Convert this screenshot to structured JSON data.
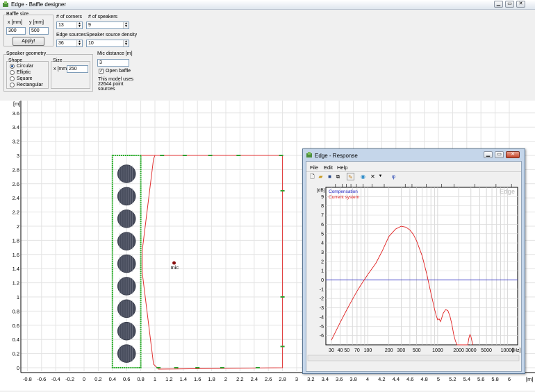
{
  "window": {
    "title": "Edge - Baffle designer"
  },
  "controls": {
    "baffle_size_label": "Baffle size",
    "x_label": "x [mm]",
    "y_label": "y [mm]",
    "x_value": "300",
    "y_value": "500",
    "apply_label": "Apply!",
    "corners_label": "# of corners",
    "corners_value": "13",
    "speakers_label": "# of speakers",
    "speakers_value": "9",
    "edge_sources_label": "Edge sources",
    "edge_sources_value": "36",
    "density_label": "Speaker source density",
    "density_value": "10",
    "geometry_label": "Speaker geometry",
    "shape_label": "Shape",
    "shapes": [
      "Circular",
      "Elliptic",
      "Square",
      "Rectangular"
    ],
    "size_label": "Size",
    "size_x_label": "x [mm]",
    "size_x_value": "250",
    "mic_distance_label": "Mic distance [m]",
    "mic_distance_value": "3",
    "open_baffle_label": "Open baffle",
    "model_info": [
      "This model uses",
      "22644 point",
      "sources"
    ]
  },
  "main_plot": {
    "unit_label": "[m]",
    "x_ticks": [
      "-0.8",
      "-0.6",
      "-0.4",
      "-0.2",
      "0",
      "0.2",
      "0.4",
      "0.6",
      "0.8",
      "1",
      "1.2",
      "1.4",
      "1.6",
      "1.8",
      "2",
      "2.2",
      "2.4",
      "2.6",
      "2.8",
      "3",
      "3.2",
      "3.4",
      "3.6",
      "3.8",
      "4",
      "4.2",
      "4.4",
      "4.6",
      "4.8",
      "5",
      "5.2",
      "5.4",
      "5.6",
      "5.8",
      "6"
    ],
    "y_ticks": [
      "0",
      "0.2",
      "0.4",
      "0.6",
      "0.8",
      "1",
      "1.2",
      "1.4",
      "1.6",
      "1.8",
      "2",
      "2.2",
      "2.4",
      "2.6",
      "2.8",
      "3",
      "3.2",
      "3.4",
      "3.6"
    ],
    "mic_label": "mic",
    "speaker_count": 9
  },
  "response_window": {
    "title": "Edge - Response",
    "menu": [
      "File",
      "Edit",
      "Help"
    ],
    "toolbar_icons": [
      "new-icon",
      "open-icon",
      "save-icon",
      "copy-icon",
      "pencil-icon",
      "globe-icon",
      "cross-icon",
      "dropdown-icon",
      "phi-icon"
    ],
    "top_axis_labels": [
      "10",
      "8",
      "7",
      "6",
      "5",
      "4",
      "3",
      "2",
      "1",
      "0.8",
      "0.5",
      "0.3",
      "0.2",
      "0.1",
      "0.05",
      "0.03"
    ],
    "top_unit": "[m]",
    "db_unit": "[dB]",
    "hz_unit": "[Hz]",
    "y_ticks": [
      "9",
      "8",
      "7",
      "6",
      "5",
      "4",
      "3",
      "2",
      "1",
      "0",
      "-1",
      "-2",
      "-3",
      "-4",
      "-5",
      "-6"
    ],
    "x_ticks": [
      "30",
      "40",
      "50",
      "70",
      "100",
      "200",
      "300",
      "500",
      "1000",
      "2000",
      "3000",
      "5000",
      "10000"
    ],
    "legend": [
      {
        "name": "Compensation",
        "color": "#2020c0"
      },
      {
        "name": "Current system",
        "color": "#e02020"
      }
    ],
    "watermark": "Edge"
  },
  "chart_data": {
    "type": "line",
    "xlabel": "[Hz]",
    "ylabel": "[dB]",
    "xscale": "log",
    "xlim": [
      25,
      14000
    ],
    "ylim": [
      -7,
      10
    ],
    "series": [
      {
        "name": "Compensation",
        "x": [
          25,
          14000
        ],
        "y": [
          0,
          0
        ]
      },
      {
        "name": "Current system",
        "x": [
          30,
          40,
          50,
          60,
          70,
          80,
          100,
          130,
          160,
          200,
          250,
          300,
          350,
          400,
          450,
          500,
          600,
          700,
          800,
          900,
          950,
          1000,
          1050,
          1100,
          1200,
          1300,
          1400,
          1500,
          1600,
          1700,
          1800,
          1900,
          2000,
          2700,
          2800,
          2900,
          3000,
          3100,
          3200
        ],
        "y": [
          -6.5,
          -4.6,
          -3.2,
          -2.1,
          -1.2,
          -0.5,
          0.6,
          1.8,
          3.1,
          4.7,
          5.5,
          5.8,
          5.7,
          5.4,
          4.9,
          4.2,
          2.6,
          0.6,
          -1.4,
          -3.1,
          -3.8,
          -4.3,
          -4.2,
          -4.5,
          -3.6,
          -3.2,
          -3.3,
          -3.9,
          -4.8,
          -5.9,
          -6.6,
          -7.0,
          -7.0,
          -7.0,
          -6.3,
          -5.9,
          -6.1,
          -6.6,
          -7.0
        ]
      }
    ]
  }
}
